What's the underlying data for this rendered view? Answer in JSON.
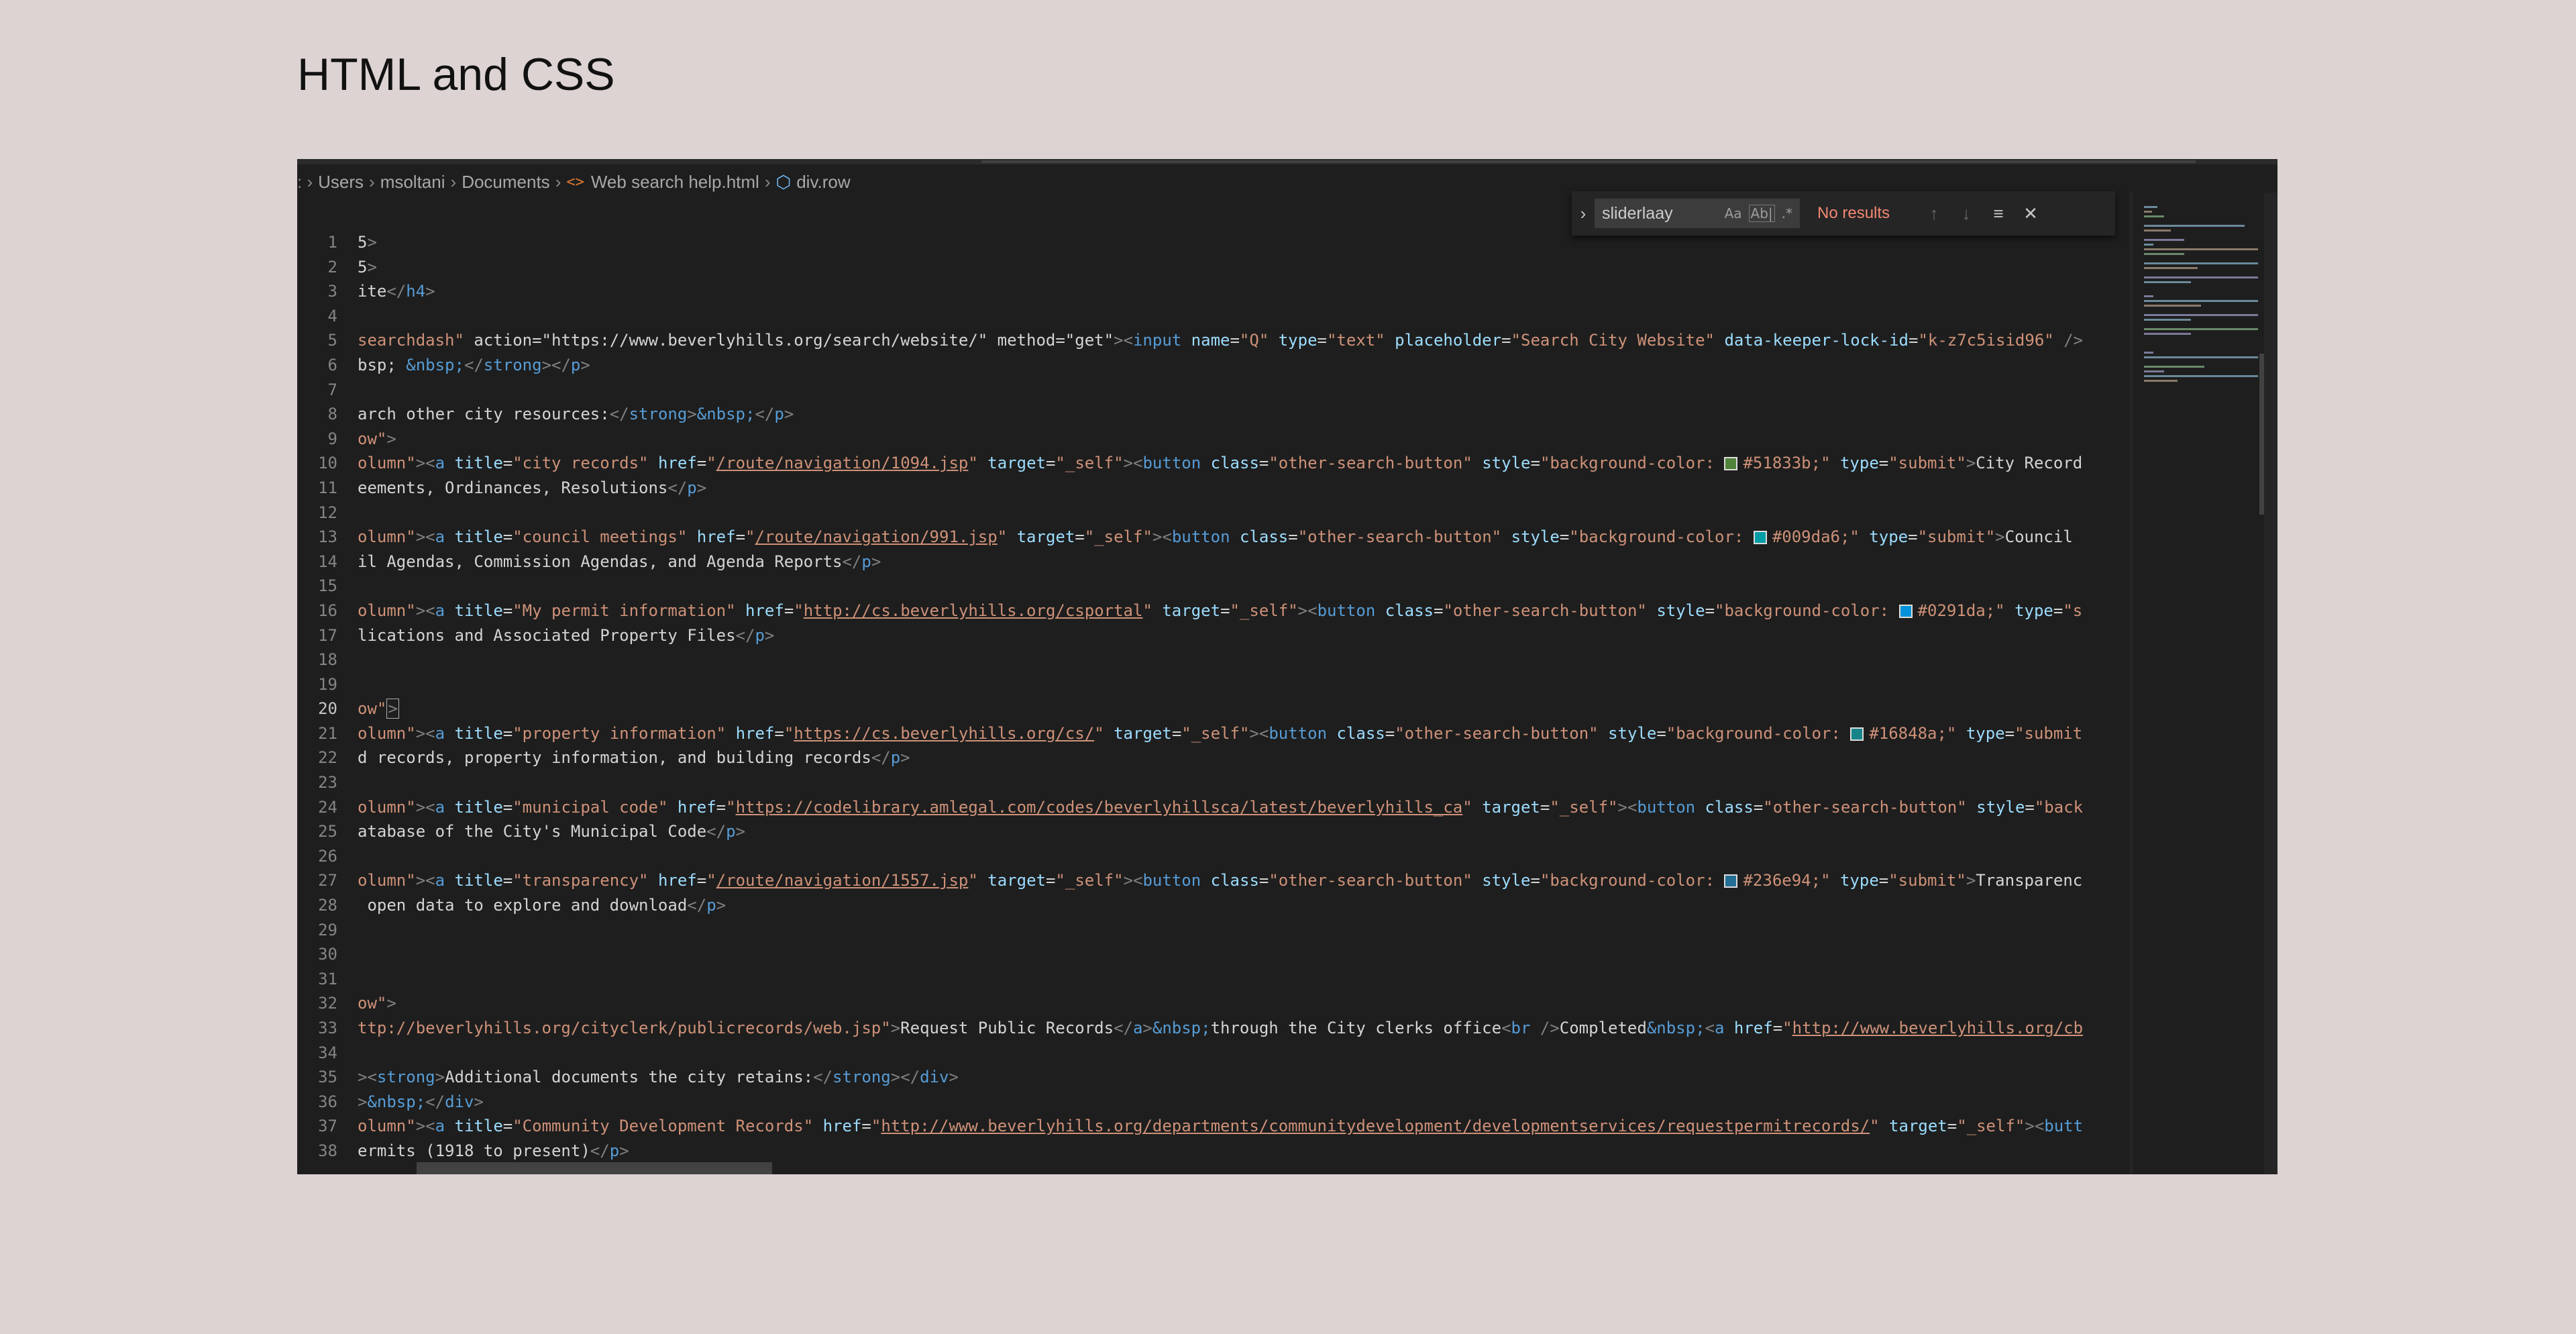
{
  "page": {
    "title": "HTML and CSS"
  },
  "breadcrumb": {
    "items": [
      "Users",
      "msoltani",
      "Documents"
    ],
    "file": "Web search help.html",
    "symbol": "div.row"
  },
  "find": {
    "query": "sliderlaay",
    "status": "No results",
    "options": [
      "Aa",
      "Ab|",
      ".*"
    ]
  },
  "editor": {
    "current_line": 20,
    "lines": [
      "5>",
      "5>",
      "ite</h4>",
      "",
      "searchdash\" action=\"https://www.beverlyhills.org/search/website/\" method=\"get\"><input name=\"Q\" type=\"text\" placeholder=\"Search City Website\" data-keeper-lock-id=\"k-z7c5isid96\" />",
      "bsp; &nbsp;</strong></p>",
      "",
      "arch other city resources:</strong>&nbsp;</p>",
      "ow\">",
      "olumn\"><a title=\"city records\" href=\"/route/navigation/1094.jsp\" target=\"_self\"><button class=\"other-search-button\" style=\"background-color: #51833b;\" type=\"submit\">City Record",
      "eements, Ordinances, Resolutions</p>",
      "",
      "olumn\"><a title=\"council meetings\" href=\"/route/navigation/991.jsp\" target=\"_self\"><button class=\"other-search-button\" style=\"background-color: #009da6;\" type=\"submit\">Council",
      "il Agendas, Commission Agendas, and Agenda Reports</p>",
      "",
      "olumn\"><a title=\"My permit information\" href=\"http://cs.beverlyhills.org/csportal\" target=\"_self\"><button class=\"other-search-button\" style=\"background-color: #0291da;\" type=\"s",
      "lications and Associated Property Files</p>",
      "",
      "",
      "ow\">",
      "olumn\"><a title=\"property information\" href=\"https://cs.beverlyhills.org/cs/\" target=\"_self\"><button class=\"other-search-button\" style=\"background-color: #16848a;\" type=\"submit",
      "d records, property information, and building records</p>",
      "",
      "olumn\"><a title=\"municipal code\" href=\"https://codelibrary.amlegal.com/codes/beverlyhillsca/latest/beverlyhills_ca\" target=\"_self\"><button class=\"other-search-button\" style=\"back",
      "atabase of the City's Municipal Code</p>",
      "",
      "olumn\"><a title=\"transparency\" href=\"/route/navigation/1557.jsp\" target=\"_self\"><button class=\"other-search-button\" style=\"background-color: #236e94;\" type=\"submit\">Transparenc",
      " open data to explore and download</p>",
      "",
      "",
      "",
      "ow\">",
      "ttp://beverlyhills.org/cityclerk/publicrecords/web.jsp\">Request Public Records</a>&nbsp;through the City clerks office<br />Completed&nbsp;<a href=\"http://www.beverlyhills.org/cb",
      "",
      "><strong>Additional documents the city retains:</strong></div>",
      ">&nbsp;</div>",
      "olumn\"><a title=\"Community Development Records\" href=\"http://www.beverlyhills.org/departments/communitydevelopment/developmentservices/requestpermitrecords/\" target=\"_self\"><butt",
      "ermits (1918 to present)</p>"
    ]
  },
  "colors": {
    "page_bg": "#ddd3d3",
    "editor_bg": "#1e1e1e",
    "swatches": [
      "#51833b",
      "#009da6",
      "#0291da",
      "#16848a",
      "#236e94"
    ]
  }
}
